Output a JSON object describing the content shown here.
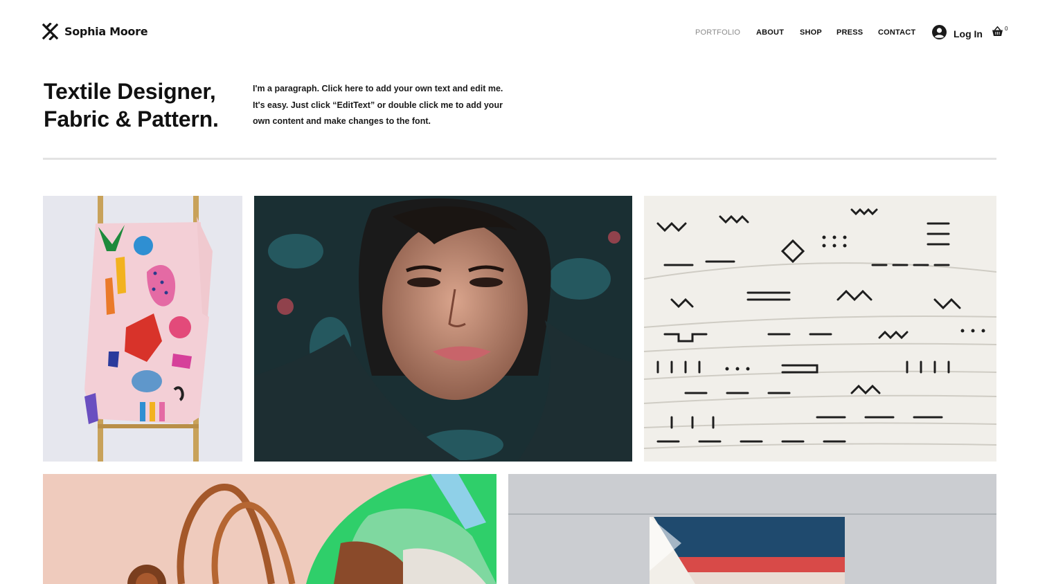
{
  "header": {
    "logo_text": "Sophia Moore",
    "logo_icon": "cross-x-icon",
    "nav": [
      {
        "label": "PORTFOLIO",
        "active": true
      },
      {
        "label": "ABOUT",
        "active": false
      },
      {
        "label": "SHOP",
        "active": false
      },
      {
        "label": "PRESS",
        "active": false
      },
      {
        "label": "CONTACT",
        "active": false
      }
    ],
    "login_label": "Log In",
    "login_icon": "user-avatar-icon",
    "cart_icon": "shopping-basket-icon",
    "cart_count": "0"
  },
  "intro": {
    "headline_line1": "Textile Designer,",
    "headline_line2": "Fabric & Pattern.",
    "paragraph": "I'm a paragraph. Click here to add your own text and edit me. It's easy. Just click “EditText” or double click me to add your own content and make changes to the font."
  },
  "gallery": {
    "tiles": [
      {
        "name": "painted-textile-on-ladder"
      },
      {
        "name": "woman-in-floral-hood"
      },
      {
        "name": "stacked-mudcloth-fabrics"
      },
      {
        "name": "tote-bag-and-silk-scarf"
      },
      {
        "name": "striped-towel-on-wall"
      }
    ]
  },
  "colors": {
    "nav_active": "#8a8a8a",
    "text": "#111111",
    "divider": "#e3e3e3"
  }
}
